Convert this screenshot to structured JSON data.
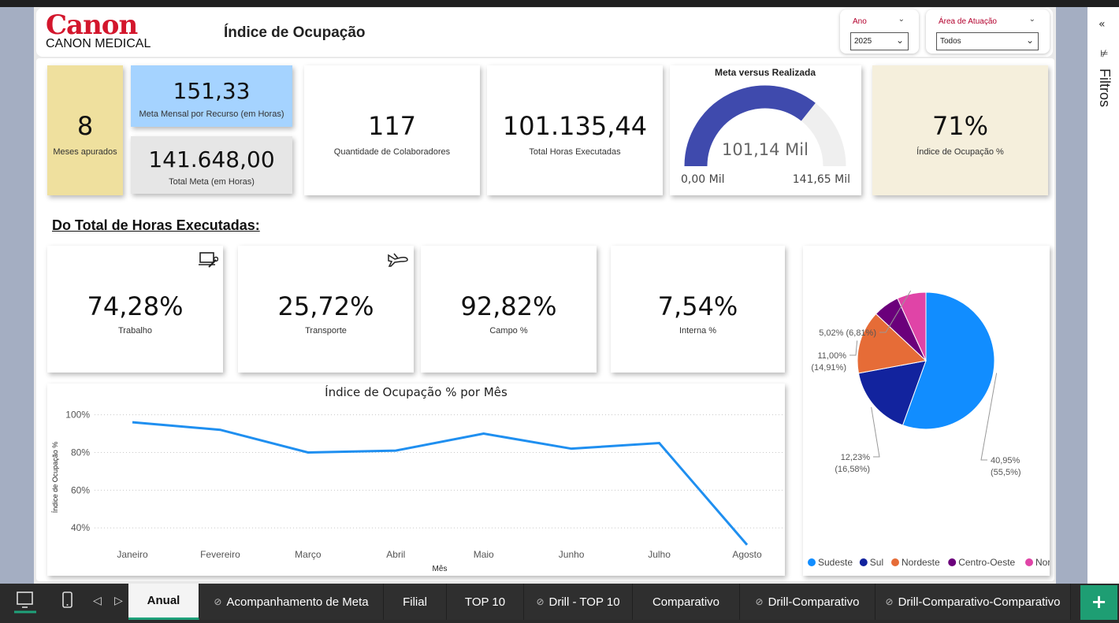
{
  "header": {
    "brand": "Canon",
    "brand_sub": "CANON MEDICAL",
    "title": "Índice de Ocupação"
  },
  "filters": {
    "year": {
      "label": "Ano",
      "value": "2025"
    },
    "area": {
      "label": "Área de Atuação",
      "value": "Todos"
    }
  },
  "kpis": {
    "meses": {
      "value": "8",
      "caption": "Meses apurados"
    },
    "meta_mensal": {
      "value": "151,33",
      "caption": "Meta Mensal por Recurso (em Horas)"
    },
    "total_meta": {
      "value": "141.648,00",
      "caption": "Total Meta (em Horas)"
    },
    "colaboradores": {
      "value": "117",
      "caption": "Quantidade de Colaboradores"
    },
    "horas_executadas": {
      "value": "101.135,44",
      "caption": "Total Horas Executadas"
    },
    "indice": {
      "value": "71%",
      "caption": "Índice de Ocupação %"
    }
  },
  "gauge": {
    "title": "Meta versus Realizada",
    "value_label": "101,14 Mil",
    "min_label": "0,00 Mil",
    "max_label": "141,65 Mil",
    "value": 101.14,
    "min": 0,
    "max": 141.65,
    "fill_color": "#3f4aad",
    "track_color": "#efefef"
  },
  "section_title": "Do Total de Horas Executadas:",
  "breakdown": [
    {
      "value": "74,28%",
      "caption": "Trabalho",
      "icon": "laptop-wrench-icon"
    },
    {
      "value": "25,72%",
      "caption": "Transporte",
      "icon": "airplane-icon"
    },
    {
      "value": "92,82%",
      "caption": "Campo %"
    },
    {
      "value": "7,54%",
      "caption": "Interna %"
    }
  ],
  "chart_data": [
    {
      "type": "line",
      "title": "Índice de Ocupação % por Mês",
      "xlabel": "Mês",
      "ylabel": "Índice de Ocupação %",
      "x": [
        "Janeiro",
        "Fevereiro",
        "Março",
        "Abril",
        "Maio",
        "Junho",
        "Julho",
        "Agosto"
      ],
      "y_ticks": [
        "100%",
        "80%",
        "60%",
        "40%"
      ],
      "ylim": [
        33,
        104
      ],
      "grid": true,
      "color": "#1f8ff0",
      "series": [
        {
          "values": [
            96,
            92,
            80,
            81,
            90,
            82,
            85,
            31
          ]
        }
      ]
    },
    {
      "type": "pie",
      "legend_position": "bottom",
      "slices": [
        {
          "name": "Sudeste",
          "value": 55.5,
          "label": "40,95%",
          "label2": "(55,5%)",
          "color": "#118dff"
        },
        {
          "name": "Sul",
          "value": 16.58,
          "label": "12,23%",
          "label2": "(16,58%)",
          "color": "#12239e"
        },
        {
          "name": "Nordeste",
          "value": 14.91,
          "label": "11,00%",
          "label2": "(14,91%)",
          "color": "#e66c37"
        },
        {
          "name": "Centro-Oeste",
          "value": 6.2,
          "label": "",
          "label2": "",
          "color": "#6b007b"
        },
        {
          "name": "Norte",
          "value": 6.81,
          "label": "5,02%",
          "label2": "(6,81%)",
          "color": "#e044a7"
        }
      ]
    }
  ],
  "tabs": [
    {
      "label": "Anual",
      "hidden": false,
      "active": true
    },
    {
      "label": "Acompanhamento de Meta",
      "hidden": true,
      "active": false
    },
    {
      "label": "Filial",
      "hidden": false,
      "active": false
    },
    {
      "label": "TOP 10",
      "hidden": false,
      "active": false
    },
    {
      "label": "Drill - TOP 10",
      "hidden": true,
      "active": false
    },
    {
      "label": "Comparativo",
      "hidden": false,
      "active": false
    },
    {
      "label": "Drill-Comparativo",
      "hidden": true,
      "active": false
    },
    {
      "label": "Drill-Comparativo-Comparativo",
      "hidden": true,
      "active": false
    }
  ],
  "filters_pane": {
    "label": "Filtros"
  }
}
